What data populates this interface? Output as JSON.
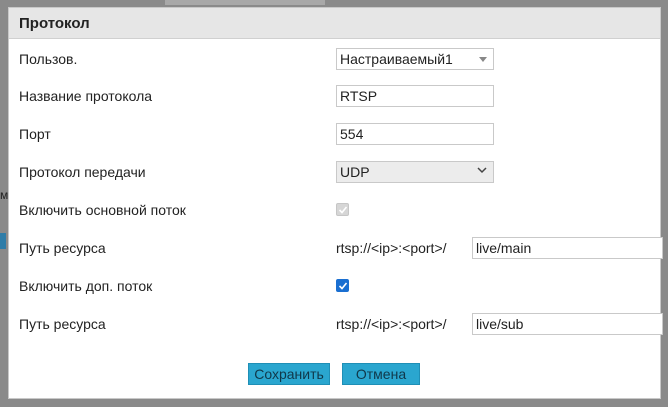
{
  "dialog": {
    "title": "Протокол"
  },
  "background": {
    "side_letter": "м"
  },
  "fields": {
    "user": {
      "label": "Пользов.",
      "value": "Настраиваемый1"
    },
    "protocol_name": {
      "label": "Название протокола",
      "value": "RTSP"
    },
    "port": {
      "label": "Порт",
      "value": "554"
    },
    "transport": {
      "label": "Протокол передачи",
      "value": "UDP"
    },
    "main_stream": {
      "label": "Включить основной поток",
      "checked": true,
      "disabled": true
    },
    "main_path": {
      "label": "Путь ресурса",
      "prefix": "rtsp://<ip>:<port>/",
      "value": "live/main"
    },
    "sub_stream": {
      "label": "Включить доп. поток",
      "checked": true,
      "disabled": false
    },
    "sub_path": {
      "label": "Путь ресурса",
      "prefix": "rtsp://<ip>:<port>/",
      "value": "live/sub"
    }
  },
  "buttons": {
    "save": "Сохранить",
    "cancel": "Отмена"
  },
  "colors": {
    "button_bg": "#2aa6cf",
    "checkbox_checked": "#1a6fd1"
  },
  "icons": {
    "user_dropdown": "caret-down-icon",
    "transport_dropdown": "chevron-down-icon",
    "checkbox": "checkmark-icon"
  }
}
